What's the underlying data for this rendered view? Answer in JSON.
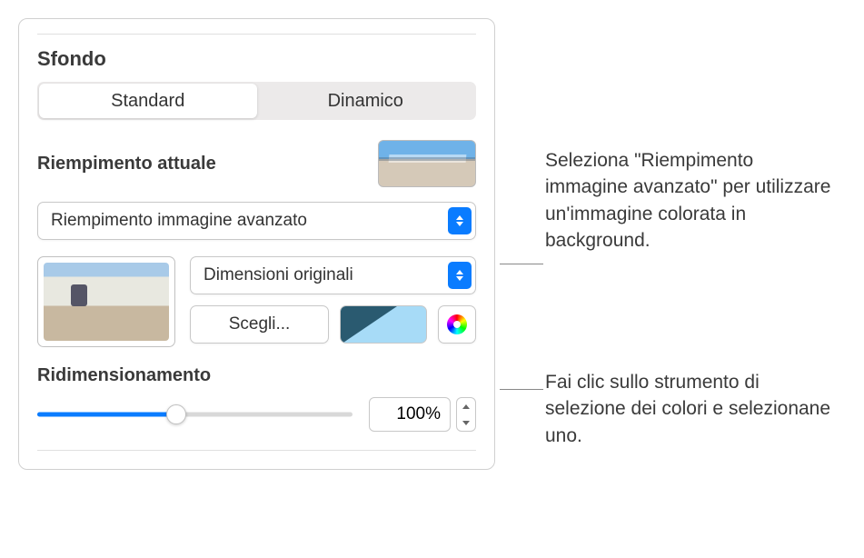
{
  "section": {
    "title": "Sfondo"
  },
  "segments": {
    "standard": "Standard",
    "dynamic": "Dinamico"
  },
  "currentFill": {
    "label": "Riempimento attuale"
  },
  "fillType": {
    "selected": "Riempimento immagine avanzato"
  },
  "imageSize": {
    "selected": "Dimensioni originali"
  },
  "chooseButton": "Scegli...",
  "resize": {
    "label": "Ridimensionamento",
    "value": "100%"
  },
  "callouts": {
    "one": "Seleziona \"Riempimento immagine avanzato\" per utilizzare un'immagine colorata in background.",
    "two": "Fai clic sullo strumento di selezione dei colori e selezionane uno."
  }
}
